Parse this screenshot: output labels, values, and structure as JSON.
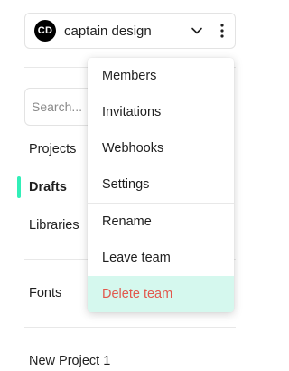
{
  "team": {
    "avatar_initials": "CD",
    "name": "captain design",
    "chevron_icon": "chevron-down-icon",
    "more_icon": "vertical-dots-icon"
  },
  "search": {
    "placeholder": "Search..."
  },
  "nav": {
    "items": [
      {
        "label": "Projects"
      },
      {
        "label": "Drafts",
        "active": true
      },
      {
        "label": "Libraries"
      }
    ],
    "fonts_label": "Fonts",
    "project_label": "New Project 1"
  },
  "menu": {
    "items": [
      {
        "label": "Members"
      },
      {
        "label": "Invitations"
      },
      {
        "label": "Webhooks"
      },
      {
        "label": "Settings"
      },
      {
        "label": "Rename"
      },
      {
        "label": "Leave team"
      },
      {
        "label": "Delete team",
        "style": "danger"
      }
    ]
  },
  "colors": {
    "accent": "#31efb8",
    "danger_text": "#e2574c",
    "danger_bg": "#d5f8ee"
  }
}
